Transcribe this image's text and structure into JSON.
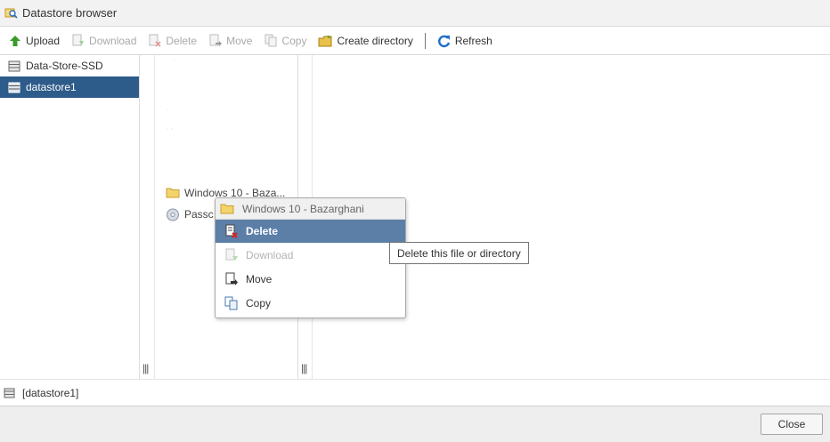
{
  "window": {
    "title": "Datastore browser"
  },
  "toolbar": {
    "upload": "Upload",
    "download": "Download",
    "delete": "Delete",
    "move": "Move",
    "copy": "Copy",
    "create_directory": "Create directory",
    "refresh": "Refresh"
  },
  "datastores": [
    {
      "label": "Data-Store-SSD",
      "selected": false
    },
    {
      "label": "datastore1",
      "selected": true
    }
  ],
  "files": [
    {
      "label": "Windows 10 - Baza...",
      "icon": "folder-icon"
    },
    {
      "label": "Passc",
      "icon": "disc-icon"
    }
  ],
  "context_menu": {
    "header": "Windows 10 - Bazarghani",
    "items": [
      {
        "label": "Delete",
        "state": "active"
      },
      {
        "label": "Download",
        "state": "disabled"
      },
      {
        "label": "Move",
        "state": "enabled"
      },
      {
        "label": "Copy",
        "state": "enabled"
      }
    ]
  },
  "tooltip": "Delete this file or directory",
  "status": {
    "path": "[datastore1]"
  },
  "footer": {
    "close": "Close"
  },
  "colors": {
    "selection": "#2d5b8a",
    "menu_highlight": "#5c7fa8",
    "upload_green": "#3a9a2a",
    "refresh_blue": "#1e6fc9",
    "folder_yellow": "#e8c14a"
  }
}
